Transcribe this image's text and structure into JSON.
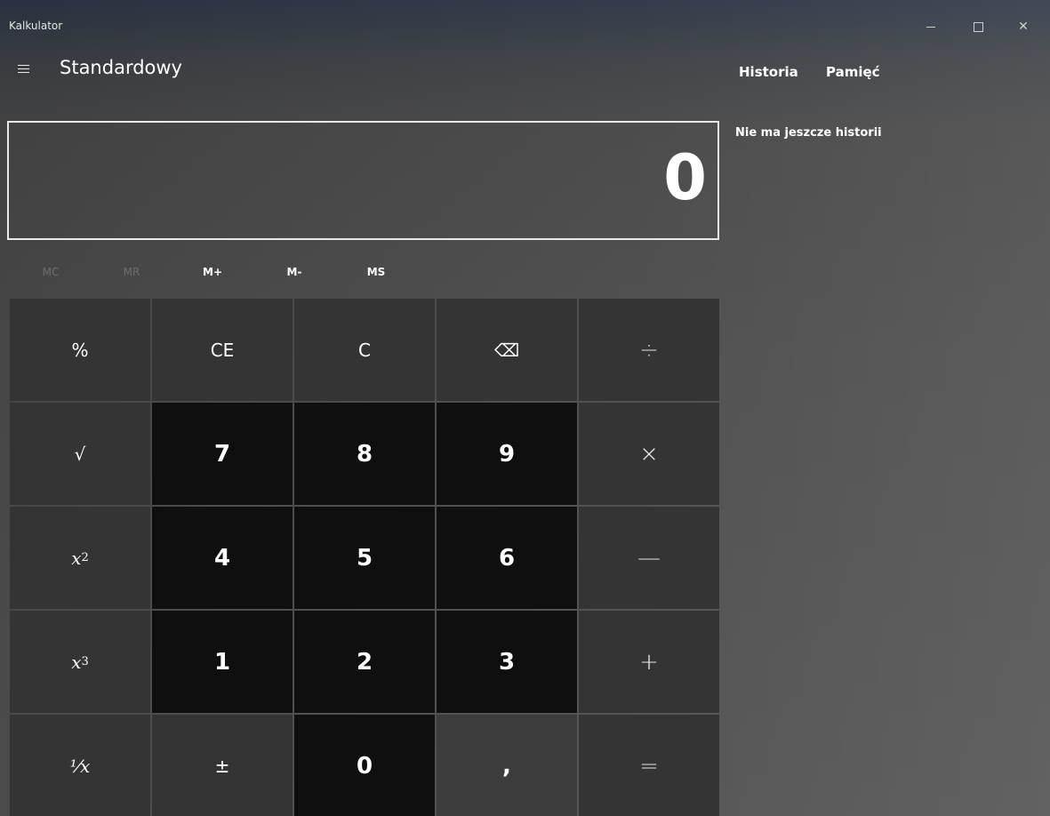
{
  "window": {
    "title": "Kalkulator"
  },
  "header": {
    "mode": "Standardowy"
  },
  "display": {
    "value": "0"
  },
  "memory": {
    "mc": "MC",
    "mr": "MR",
    "mplus": "M+",
    "mminus": "M-",
    "ms": "MS"
  },
  "keys": {
    "percent": "%",
    "ce": "CE",
    "c": "C",
    "backspace": "⌫",
    "divide": "÷",
    "sqrt": "√",
    "seven": "7",
    "eight": "8",
    "nine": "9",
    "multiply": "×",
    "square_base": "x",
    "square_exp": "2",
    "four": "4",
    "five": "5",
    "six": "6",
    "minus": "—",
    "cube_base": "x",
    "cube_exp": "3",
    "one": "1",
    "two": "2",
    "three": "3",
    "plus": "+",
    "reciprocal": "⅟x",
    "negate": "±",
    "zero": "0",
    "decimal": ",",
    "equals": "="
  },
  "side_panel": {
    "tab_history": "Historia",
    "tab_memory": "Pamięć",
    "empty_message": "Nie ma jeszcze historii"
  }
}
